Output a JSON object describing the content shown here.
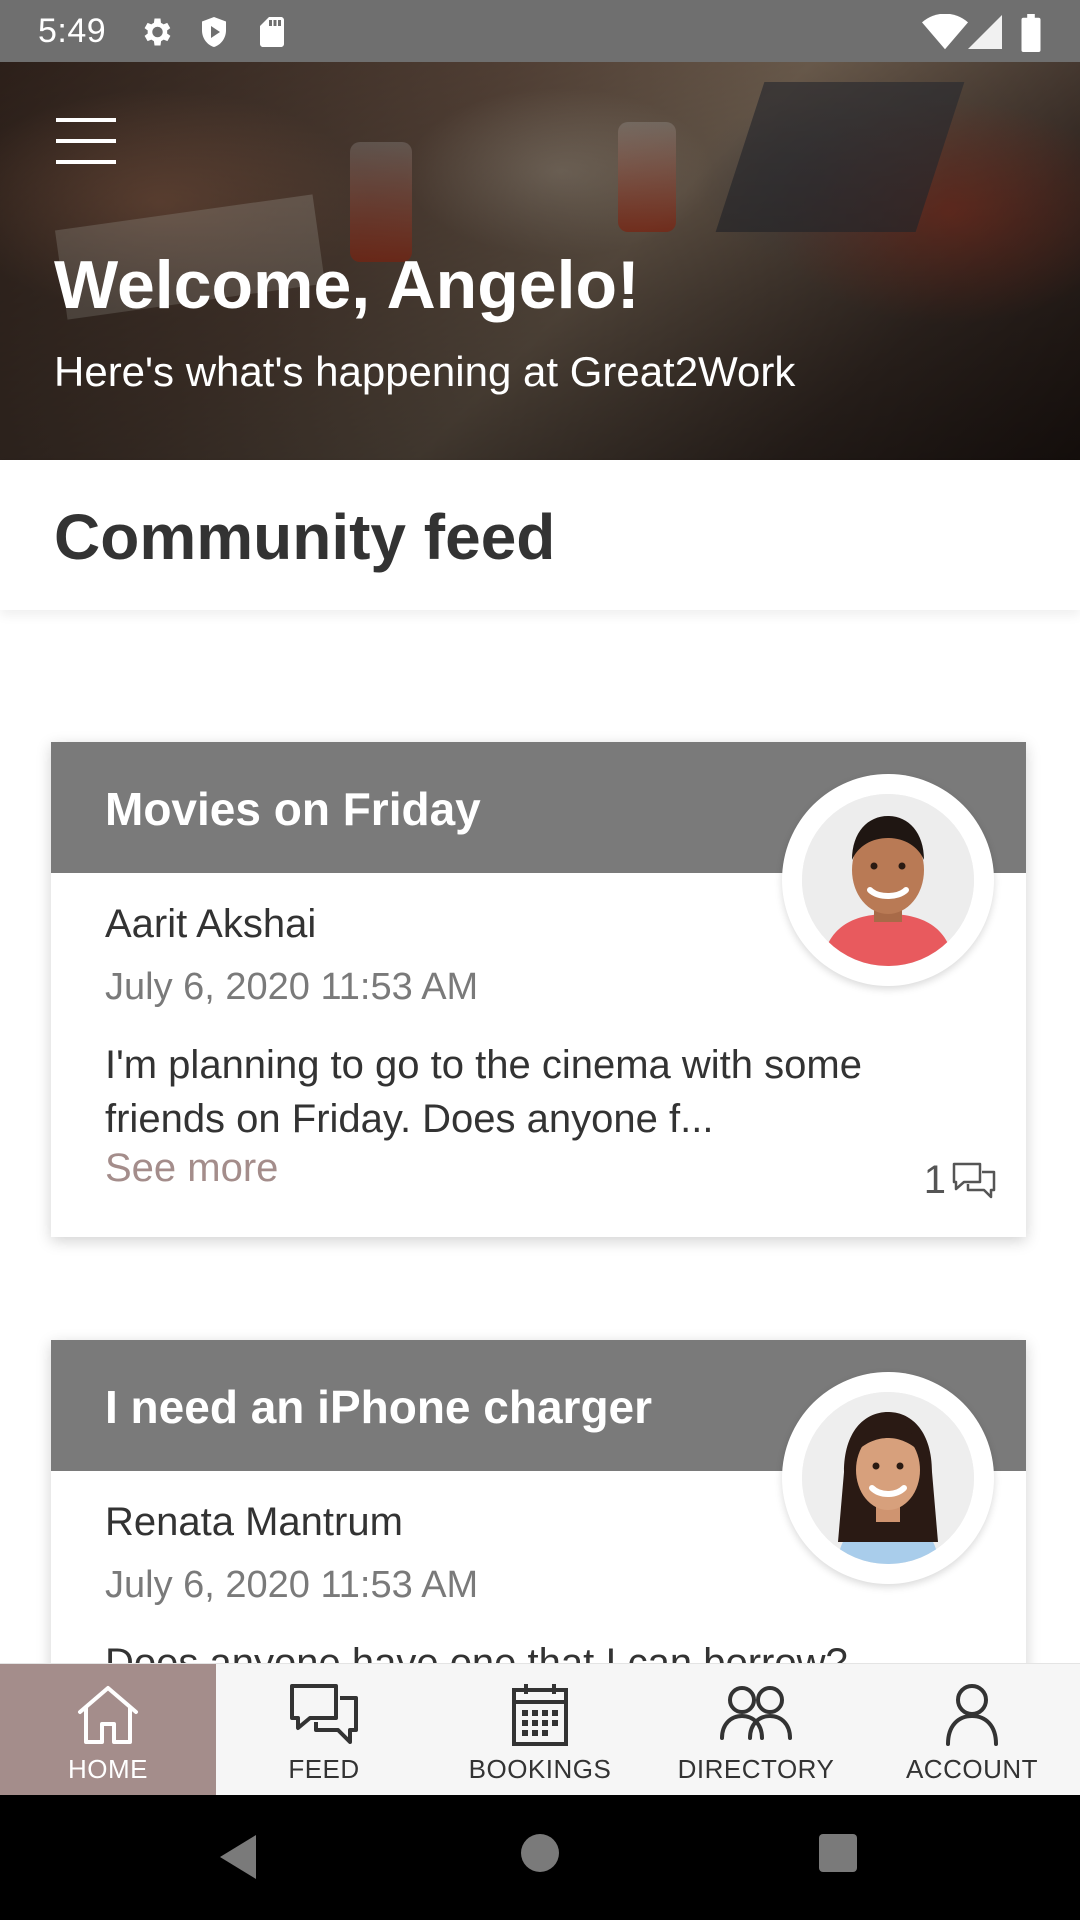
{
  "status_bar": {
    "time": "5:49",
    "icons": [
      "gear-icon",
      "shield-icon",
      "sd-card-icon"
    ],
    "right_icons": [
      "wifi-icon",
      "cell-signal-icon",
      "battery-icon"
    ]
  },
  "hero": {
    "title": "Welcome, Angelo!",
    "subtitle": "Here's what's happening at Great2Work",
    "menu_icon": "hamburger-menu-icon"
  },
  "section": {
    "title": "Community feed"
  },
  "posts": [
    {
      "title": "Movies on Friday",
      "author": "Aarit Akshai",
      "date": "July 6, 2020 11:53 AM",
      "body": "I'm planning to go to the cinema with some friends on Friday. Does anyone f...",
      "see_more": "See more",
      "comments": "1"
    },
    {
      "title": "I need an iPhone charger",
      "author": "Renata Mantrum",
      "date": "July 6, 2020 11:53 AM",
      "body": "Does anyone have one that I can borrow?"
    }
  ],
  "bottom_nav": {
    "items": [
      {
        "label": "HOME",
        "icon": "home-icon",
        "active": true
      },
      {
        "label": "FEED",
        "icon": "chat-bubbles-icon",
        "active": false
      },
      {
        "label": "BOOKINGS",
        "icon": "calendar-icon",
        "active": false
      },
      {
        "label": "DIRECTORY",
        "icon": "people-icon",
        "active": false
      },
      {
        "label": "ACCOUNT",
        "icon": "person-icon",
        "active": false
      }
    ]
  },
  "colors": {
    "status_bar": "#6f6f6f",
    "card_header": "#7a7a7a",
    "accent": "#a48d8b",
    "nav_background": "#f6f6f6"
  }
}
